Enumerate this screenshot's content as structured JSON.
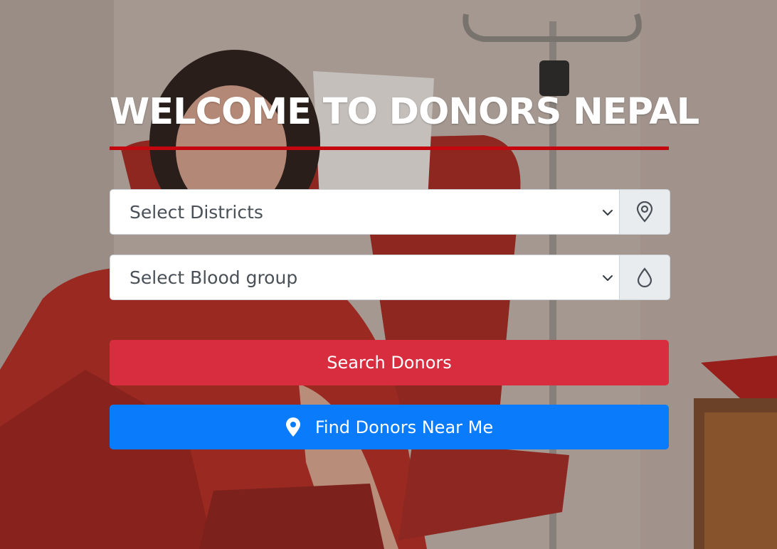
{
  "hero": {
    "title": "WELCOME TO DONORS NEPAL",
    "accent_color": "#c4060e",
    "background_description_icon": "blood-donation-photo"
  },
  "form": {
    "district_select": {
      "selected": "Select Districts",
      "icon": "map-pin-outline-icon"
    },
    "blood_group_select": {
      "selected": "Select Blood group",
      "icon": "blood-drop-outline-icon"
    },
    "search_button": {
      "label": "Search Donors",
      "color": "#d72d3e"
    },
    "near_me_button": {
      "label": "Find Donors Near Me",
      "icon": "map-pin-icon",
      "color": "#0a7bfb"
    }
  }
}
